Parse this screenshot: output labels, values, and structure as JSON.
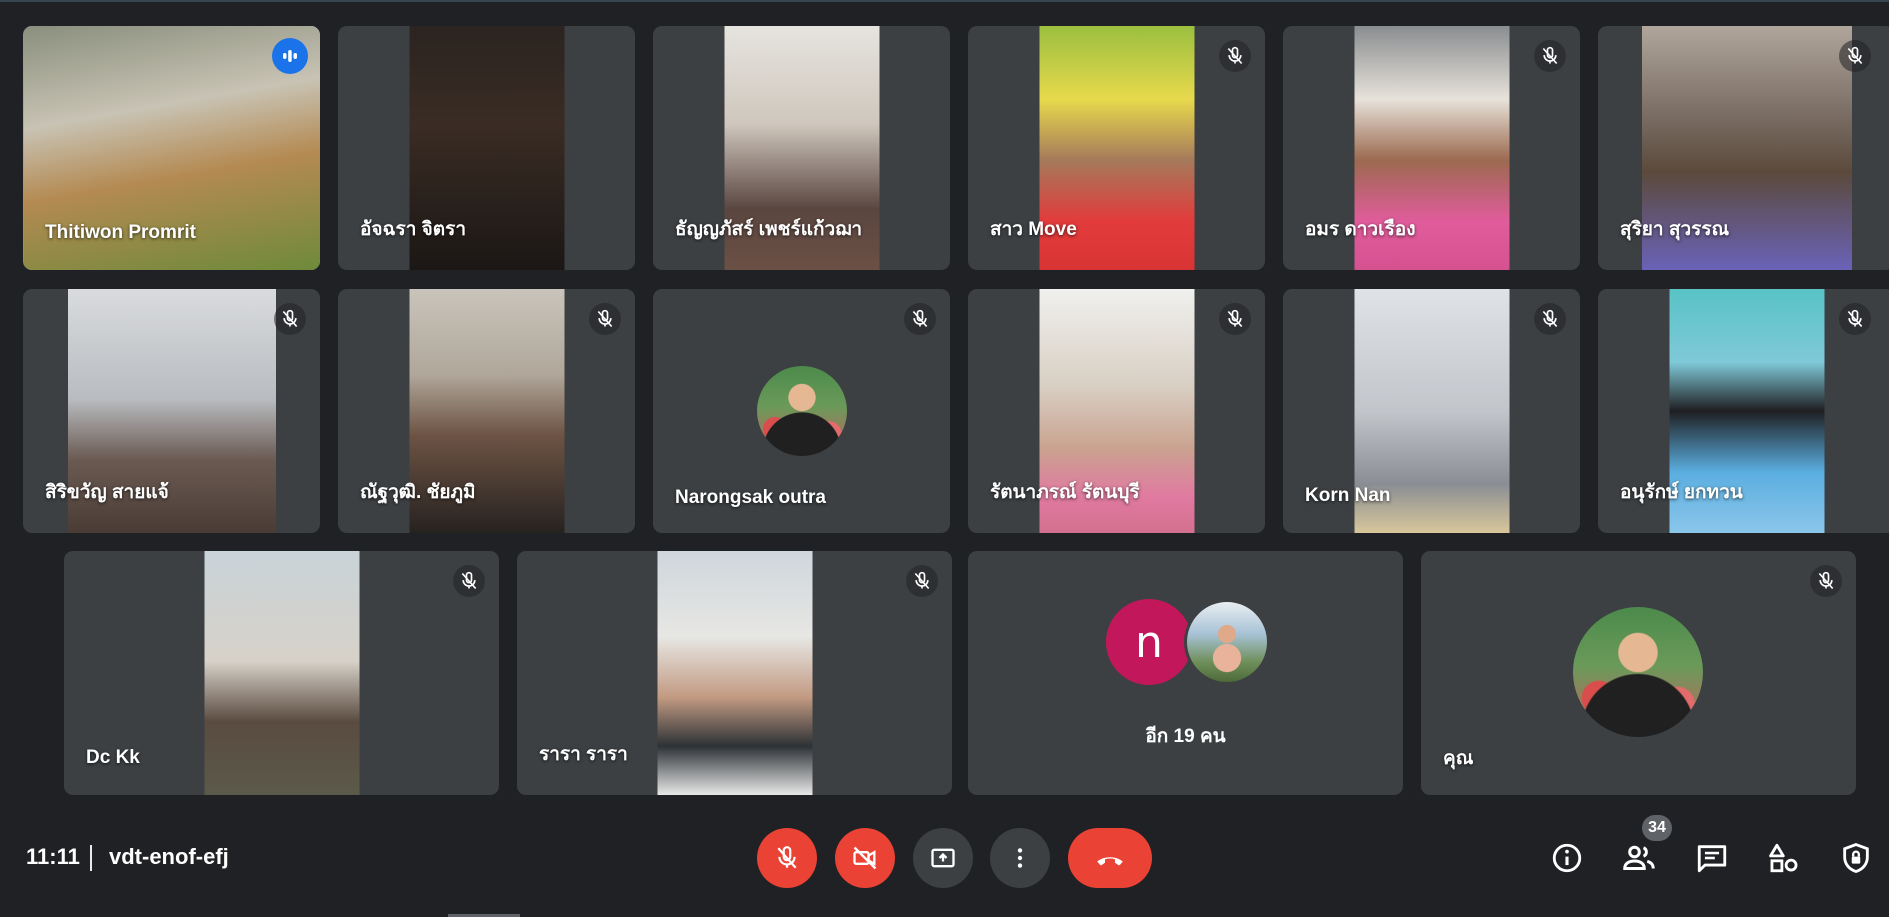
{
  "meeting": {
    "time": "11:11",
    "code": "vdt-enof-efj",
    "participant_count": "34"
  },
  "tiles": [
    {
      "name": "Thitiwon Promrit"
    },
    {
      "name": "อัจฉรา จิตรา"
    },
    {
      "name": "ธัญญภัสร์ เพชร์แก้วฌา"
    },
    {
      "name": "สาว Move"
    },
    {
      "name": "อมร ดาวเรือง"
    },
    {
      "name": "สุริยา สุวรรณ"
    },
    {
      "name": "สิริขวัญ สายแจ้"
    },
    {
      "name": "ณัฐวุฒิ. ชัยภูมิ"
    },
    {
      "name": "Narongsak outra"
    },
    {
      "name": "รัตนาภรณ์ รัตนบุรี"
    },
    {
      "name": "Korn Nan"
    },
    {
      "name": "อนุรักษ์ ยกทวน"
    },
    {
      "name": "Dc Kk"
    },
    {
      "name": "รารา รารา"
    },
    {
      "name": "อีก 19 คน",
      "avatar_letter": "n"
    },
    {
      "name": "คุณ"
    }
  ],
  "controls": {
    "mic": "mic-off-icon",
    "camera": "videocam-off-icon",
    "present": "present-screen-icon",
    "more": "more-vert-icon",
    "leave": "call-end-icon"
  },
  "colors": {
    "background": "#202124",
    "tile": "#3c4043",
    "danger": "#ea4335",
    "speaking": "#1a73e8",
    "avatar_n": "#c2185b"
  }
}
